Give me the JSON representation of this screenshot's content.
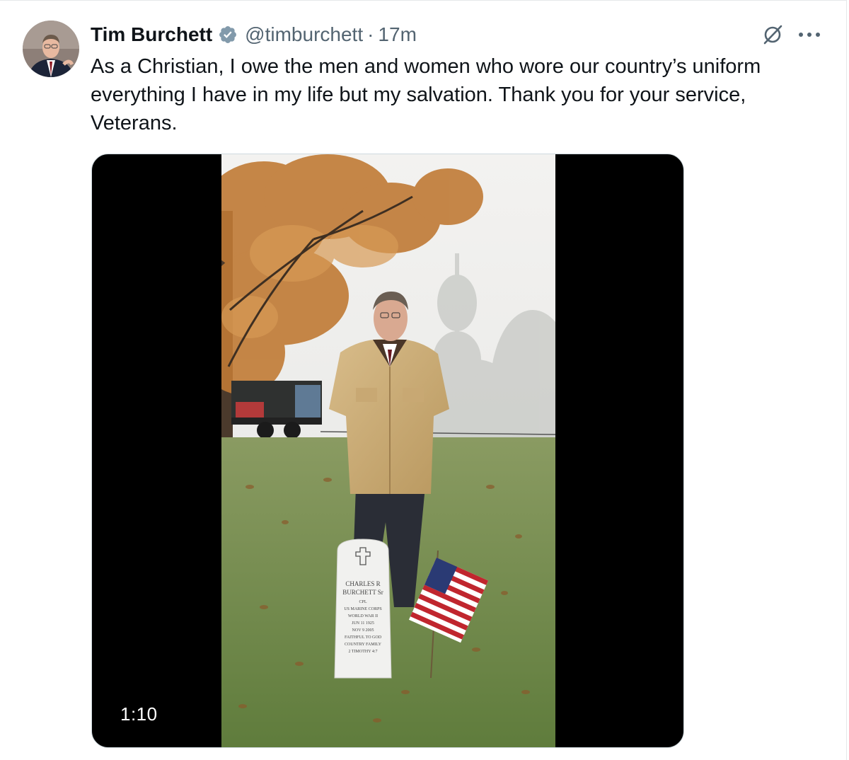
{
  "tweet": {
    "author_name": "Tim Burchett",
    "handle": "@timburchett",
    "separator": "·",
    "time": "17m",
    "text": "As a Christian, I owe the men and women who wore our country’s uniform everything I have in my life but my salvation. Thank you for your service, Veterans.",
    "verified_icon": "verified-badge-icon",
    "verified_color": "#829aab"
  },
  "actions": {
    "grok_icon": "grok-icon",
    "more_icon": "more-options-icon"
  },
  "media": {
    "type": "video",
    "duration": "1:10",
    "headstone_lines": [
      "CHARLES R",
      "BURCHETT Sr",
      "CPL",
      "US MARINE CORPS",
      "WORLD WAR II",
      "JUN 11 1925",
      "NOV 9 2005",
      "FAITHFUL TO GOD",
      "COUNTRY FAMILY",
      "2 TIMOTHY 4:7"
    ]
  }
}
